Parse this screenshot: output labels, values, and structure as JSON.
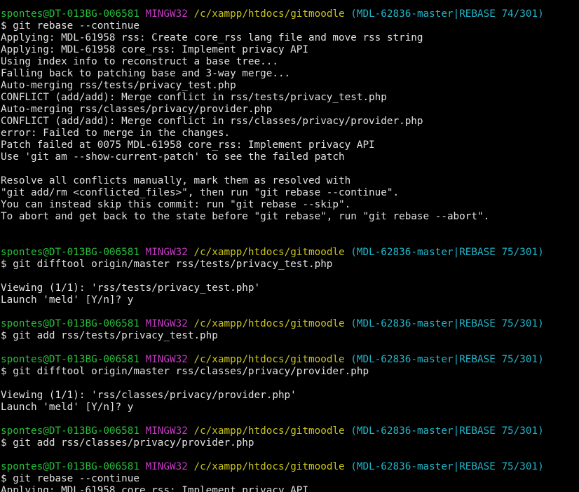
{
  "theme": {
    "background": "#000000",
    "text": "#e0e0e0",
    "user_host": "#27c03a",
    "mingw": "#c339c3",
    "path": "#c9c41c",
    "branch": "#1fb5c9"
  },
  "terminal": {
    "lines": [
      {
        "type": "prompt",
        "user": "spontes@DT-013BG-006581",
        "env": "MINGW32",
        "path": "/c/xampp/htdocs/gitmoodle",
        "branch": "(MDL-62836-master|REBASE 74/301)"
      },
      {
        "type": "text",
        "text": "$ git rebase --continue"
      },
      {
        "type": "text",
        "text": "Applying: MDL-61958 rss: Create core_rss lang file and move rss string"
      },
      {
        "type": "text",
        "text": "Applying: MDL-61958 core_rss: Implement privacy API"
      },
      {
        "type": "text",
        "text": "Using index info to reconstruct a base tree..."
      },
      {
        "type": "text",
        "text": "Falling back to patching base and 3-way merge..."
      },
      {
        "type": "text",
        "text": "Auto-merging rss/tests/privacy_test.php"
      },
      {
        "type": "text",
        "text": "CONFLICT (add/add): Merge conflict in rss/tests/privacy_test.php"
      },
      {
        "type": "text",
        "text": "Auto-merging rss/classes/privacy/provider.php"
      },
      {
        "type": "text",
        "text": "CONFLICT (add/add): Merge conflict in rss/classes/privacy/provider.php"
      },
      {
        "type": "text",
        "text": "error: Failed to merge in the changes."
      },
      {
        "type": "text",
        "text": "Patch failed at 0075 MDL-61958 core_rss: Implement privacy API"
      },
      {
        "type": "text",
        "text": "Use 'git am --show-current-patch' to see the failed patch"
      },
      {
        "type": "text",
        "text": ""
      },
      {
        "type": "text",
        "text": "Resolve all conflicts manually, mark them as resolved with"
      },
      {
        "type": "text",
        "text": "\"git add/rm <conflicted_files>\", then run \"git rebase --continue\"."
      },
      {
        "type": "text",
        "text": "You can instead skip this commit: run \"git rebase --skip\"."
      },
      {
        "type": "text",
        "text": "To abort and get back to the state before \"git rebase\", run \"git rebase --abort\"."
      },
      {
        "type": "text",
        "text": ""
      },
      {
        "type": "text",
        "text": ""
      },
      {
        "type": "prompt",
        "user": "spontes@DT-013BG-006581",
        "env": "MINGW32",
        "path": "/c/xampp/htdocs/gitmoodle",
        "branch": "(MDL-62836-master|REBASE 75/301)"
      },
      {
        "type": "text",
        "text": "$ git difftool origin/master rss/tests/privacy_test.php"
      },
      {
        "type": "text",
        "text": ""
      },
      {
        "type": "text",
        "text": "Viewing (1/1): 'rss/tests/privacy_test.php'"
      },
      {
        "type": "text",
        "text": "Launch 'meld' [Y/n]? y"
      },
      {
        "type": "text",
        "text": ""
      },
      {
        "type": "prompt",
        "user": "spontes@DT-013BG-006581",
        "env": "MINGW32",
        "path": "/c/xampp/htdocs/gitmoodle",
        "branch": "(MDL-62836-master|REBASE 75/301)"
      },
      {
        "type": "text",
        "text": "$ git add rss/tests/privacy_test.php"
      },
      {
        "type": "text",
        "text": ""
      },
      {
        "type": "prompt",
        "user": "spontes@DT-013BG-006581",
        "env": "MINGW32",
        "path": "/c/xampp/htdocs/gitmoodle",
        "branch": "(MDL-62836-master|REBASE 75/301)"
      },
      {
        "type": "text",
        "text": "$ git difftool origin/master rss/classes/privacy/provider.php"
      },
      {
        "type": "text",
        "text": ""
      },
      {
        "type": "text",
        "text": "Viewing (1/1): 'rss/classes/privacy/provider.php'"
      },
      {
        "type": "text",
        "text": "Launch 'meld' [Y/n]? y"
      },
      {
        "type": "text",
        "text": ""
      },
      {
        "type": "prompt",
        "user": "spontes@DT-013BG-006581",
        "env": "MINGW32",
        "path": "/c/xampp/htdocs/gitmoodle",
        "branch": "(MDL-62836-master|REBASE 75/301)"
      },
      {
        "type": "text",
        "text": "$ git add rss/classes/privacy/provider.php"
      },
      {
        "type": "text",
        "text": ""
      },
      {
        "type": "prompt",
        "user": "spontes@DT-013BG-006581",
        "env": "MINGW32",
        "path": "/c/xampp/htdocs/gitmoodle",
        "branch": "(MDL-62836-master|REBASE 75/301)"
      },
      {
        "type": "text",
        "text": "$ git rebase --continue"
      },
      {
        "type": "text",
        "text": "Applying: MDL-61958 core_rss: Implement privacy API"
      }
    ]
  }
}
